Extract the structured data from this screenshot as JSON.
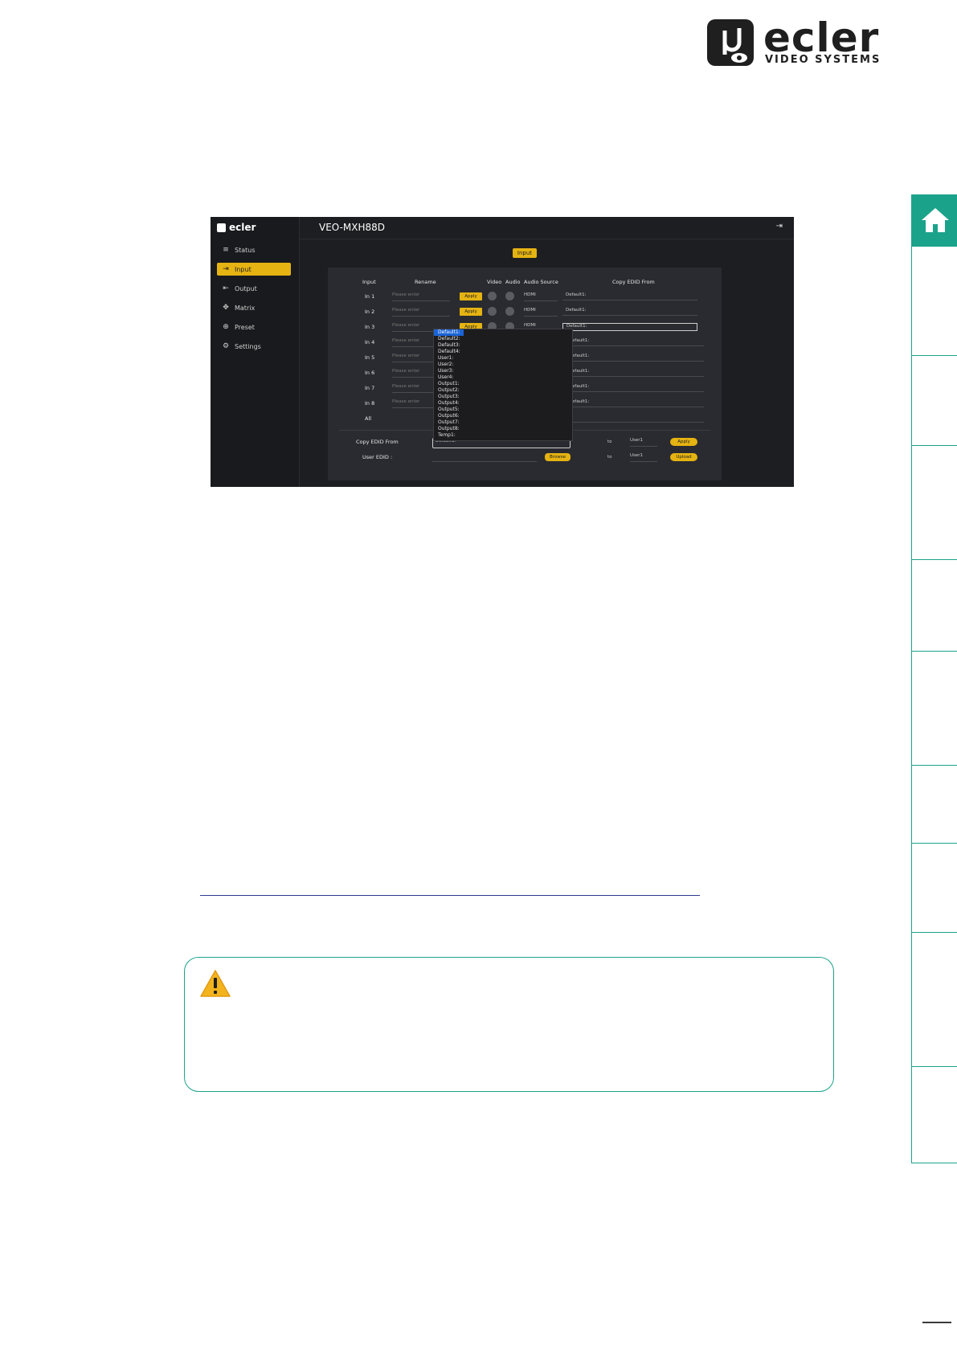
{
  "brand": {
    "name": "ecler",
    "tagline": "VIDEO SYSTEMS"
  },
  "side_tabs": {
    "home_icon": "home-icon"
  },
  "screenshot": {
    "logo_text": "ecler",
    "device_title": "VEO-MXH88D",
    "active_tab": "Input",
    "nav": [
      {
        "icon": "≡",
        "label": "Status"
      },
      {
        "icon": "⇥",
        "label": "Input"
      },
      {
        "icon": "⇤",
        "label": "Output"
      },
      {
        "icon": "✥",
        "label": "Matrix"
      },
      {
        "icon": "⊕",
        "label": "Preset"
      },
      {
        "icon": "⚙",
        "label": "Settings"
      }
    ],
    "headers": {
      "input": "Input",
      "rename": "Rename",
      "video": "Video",
      "audio": "Audio",
      "audio_source": "Audio Source",
      "copy_edid_from": "Copy EDID From"
    },
    "rows": [
      {
        "label": "In 1",
        "placeholder": "Please enter",
        "apply": "Apply",
        "source": "HDMI",
        "edid": "Default1:"
      },
      {
        "label": "In 2",
        "placeholder": "Please enter",
        "apply": "Apply",
        "source": "HDMI",
        "edid": "Default1:"
      },
      {
        "label": "In 3",
        "placeholder": "Please enter",
        "apply": "Apply",
        "source": "HDMI",
        "edid": "Default1:"
      },
      {
        "label": "In 4",
        "placeholder": "Please enter",
        "apply": "",
        "source": "",
        "edid": "efault1:"
      },
      {
        "label": "In 5",
        "placeholder": "Please enter",
        "apply": "",
        "source": "",
        "edid": "efault1:"
      },
      {
        "label": "In 6",
        "placeholder": "Please enter",
        "apply": "",
        "source": "",
        "edid": "efault1:"
      },
      {
        "label": "In 7",
        "placeholder": "Please enter",
        "apply": "",
        "source": "",
        "edid": "efault1:"
      },
      {
        "label": "In 8",
        "placeholder": "Please enter",
        "apply": "",
        "source": "",
        "edid": "efault1:"
      },
      {
        "label": "All",
        "placeholder": "",
        "apply": "",
        "source": "",
        "edid": ""
      }
    ],
    "dropdown_options": [
      "Default1:",
      "Default2:",
      "Default3:",
      "Default4:",
      "User1:",
      "User2:",
      "User3:",
      "User4:",
      "Output1:",
      "Output2:",
      "Output3:",
      "Output4:",
      "Output5:",
      "Output6:",
      "Output7:",
      "Output8:",
      "Temp1:"
    ],
    "copy_edid_label": "Copy EDID From",
    "copy_edid_value": "Default1:",
    "user_edid_label": "User EDID :",
    "browse_label": "Browse",
    "to_label": "to",
    "target_1": "User1",
    "target_2": "User1",
    "apply_label": "Apply",
    "upload_label": "Upload"
  }
}
